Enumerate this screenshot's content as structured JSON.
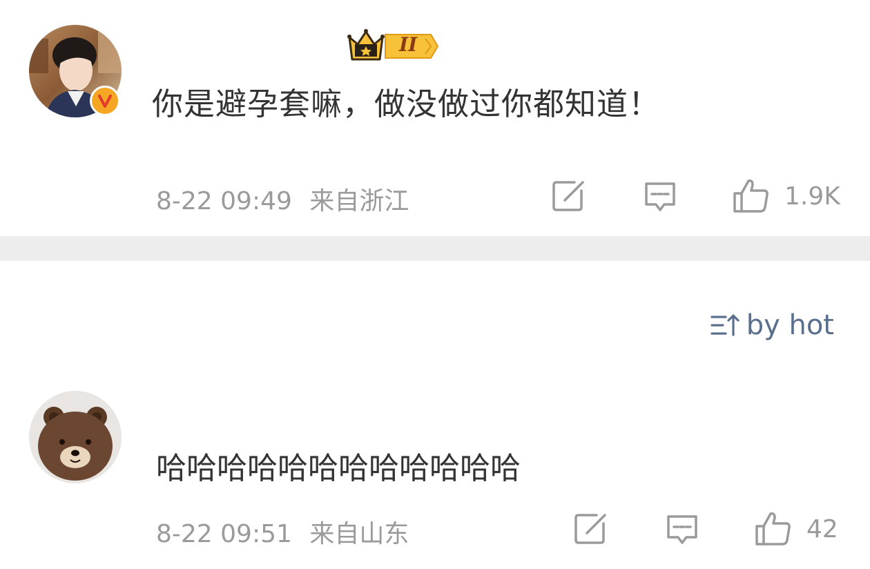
{
  "comments": [
    {
      "text": "你是避孕套嘛，做没做过你都知道！",
      "timestamp": "8-22 09:49",
      "location": "来自浙江",
      "likes": "1.9K",
      "level_badge": "II",
      "verified_badge": "V",
      "avatar": "young-man-portrait"
    },
    {
      "text": "哈哈哈哈哈哈哈哈哈哈哈哈",
      "timestamp": "8-22 09:51",
      "location": "来自山东",
      "likes": "42",
      "avatar": "brown-bear-plush"
    }
  ],
  "sort": {
    "label": "by hot",
    "icon": "sort-icon"
  },
  "icons": {
    "repost": "repost-icon",
    "comment": "comment-icon",
    "like": "thumbs-up-icon"
  },
  "colors": {
    "text": "#333333",
    "meta": "#9a9a9a",
    "sort_accent": "#5a6e8e",
    "verified": "#f5a623",
    "divider": "#ededed"
  }
}
